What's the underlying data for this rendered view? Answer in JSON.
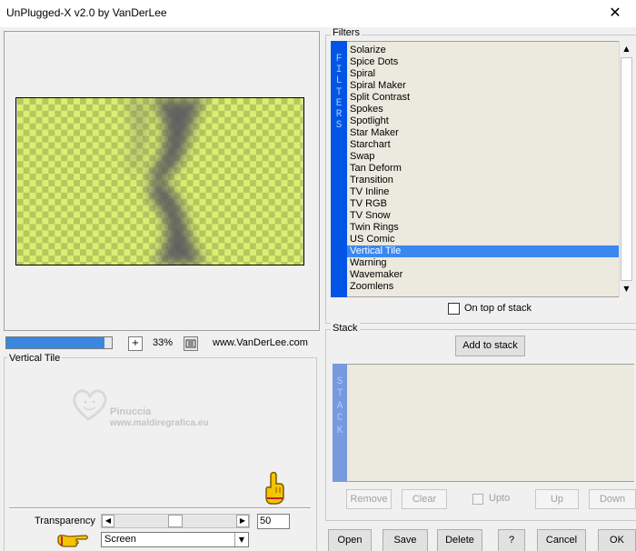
{
  "window": {
    "title": "UnPlugged-X v2.0 by VanDerLee",
    "close_glyph": "✕"
  },
  "preview": {
    "zoom_in_label": "+",
    "zoom_label": "33%",
    "progress_fraction": 0.93,
    "website": "www.VanDerLee.com"
  },
  "settings": {
    "group_title": "Vertical Tile",
    "watermark_line1": "Pinuccia",
    "watermark_line2": "www.maldiregrafica.eu",
    "transparency_label": "Transparency",
    "transparency_value": "50",
    "transparency_fraction": 0.5,
    "blend_mode": "Screen",
    "arrow_left": "◀",
    "arrow_right": "▶",
    "arrow_down": "▼"
  },
  "filters": {
    "group_title": "Filters",
    "bar_letters": [
      "F",
      "I",
      "L",
      "T",
      "E",
      "R",
      "S"
    ],
    "items": [
      "Solarize",
      "Spice Dots",
      "Spiral",
      "Spiral Maker",
      "Split Contrast",
      "Spokes",
      "Spotlight",
      "Star Maker",
      "Starchart",
      "Swap",
      "Tan Deform",
      "Transition",
      "TV Inline",
      "TV RGB",
      "TV Snow",
      "Twin Rings",
      "US Comic",
      "Vertical Tile",
      "Warning",
      "Wavemaker",
      "Zoomlens"
    ],
    "selected": "Vertical Tile",
    "scroll_up": "▲",
    "scroll_down": "▼",
    "on_top_label": "On top of stack",
    "on_top_checked": false
  },
  "stack": {
    "group_title": "Stack",
    "add_button": "Add to stack",
    "bar_letters": [
      "S",
      "T",
      "A",
      "C",
      "K"
    ],
    "remove_button": "Remove",
    "clear_button": "Clear",
    "upto_label": "Upto",
    "up_button": "Up",
    "down_button": "Down"
  },
  "footer": {
    "open": "Open",
    "save": "Save",
    "delete": "Delete",
    "help": "?",
    "cancel": "Cancel",
    "ok": "OK"
  },
  "colors": {
    "preview_yellow": "#d6ec63",
    "preview_gray": "#6e6e72",
    "filter_bar": "#0055e6",
    "stack_bar": "#7799dd",
    "selection": "#3a87f0",
    "progress": "#3a87e0"
  }
}
